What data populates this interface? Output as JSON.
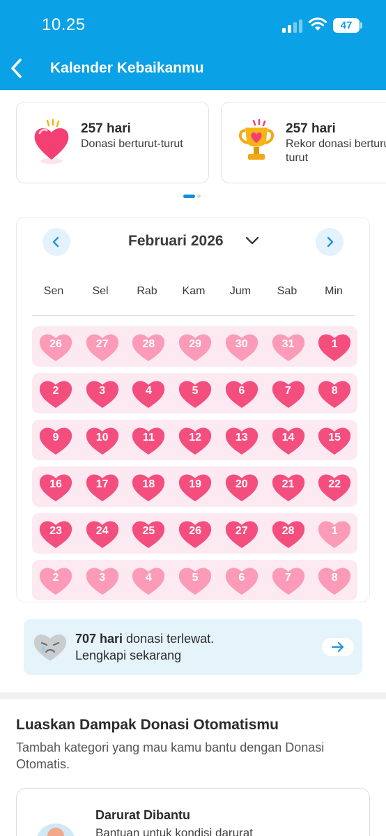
{
  "status_bar": {
    "time": "10.25",
    "battery": "47"
  },
  "header": {
    "title": "Kalender Kebaikanmu"
  },
  "stat_cards": [
    {
      "value": "257 hari",
      "label": "Donasi berturut-turut",
      "icon": "heart-icon"
    },
    {
      "value": "257 hari",
      "label": "Rekor donasi berturut-turut",
      "icon": "trophy-icon"
    }
  ],
  "calendar": {
    "month_label": "Februari 2026",
    "weekdays": [
      "Sen",
      "Sel",
      "Rab",
      "Kam",
      "Jum",
      "Sab",
      "Min"
    ],
    "colors": {
      "donated": "#f44e7f",
      "outside_month": "#fb9bb7",
      "week_bg": "#fde9f1"
    },
    "weeks": [
      [
        {
          "d": "26",
          "cur": false
        },
        {
          "d": "27",
          "cur": false
        },
        {
          "d": "28",
          "cur": false
        },
        {
          "d": "29",
          "cur": false
        },
        {
          "d": "30",
          "cur": false
        },
        {
          "d": "31",
          "cur": false
        },
        {
          "d": "1",
          "cur": true
        }
      ],
      [
        {
          "d": "2",
          "cur": true
        },
        {
          "d": "3",
          "cur": true
        },
        {
          "d": "4",
          "cur": true
        },
        {
          "d": "5",
          "cur": true
        },
        {
          "d": "6",
          "cur": true
        },
        {
          "d": "7",
          "cur": true
        },
        {
          "d": "8",
          "cur": true
        }
      ],
      [
        {
          "d": "9",
          "cur": true
        },
        {
          "d": "10",
          "cur": true
        },
        {
          "d": "11",
          "cur": true
        },
        {
          "d": "12",
          "cur": true
        },
        {
          "d": "13",
          "cur": true
        },
        {
          "d": "14",
          "cur": true
        },
        {
          "d": "15",
          "cur": true
        }
      ],
      [
        {
          "d": "16",
          "cur": true
        },
        {
          "d": "17",
          "cur": true
        },
        {
          "d": "18",
          "cur": true
        },
        {
          "d": "19",
          "cur": true
        },
        {
          "d": "20",
          "cur": true
        },
        {
          "d": "21",
          "cur": true
        },
        {
          "d": "22",
          "cur": true
        }
      ],
      [
        {
          "d": "23",
          "cur": true
        },
        {
          "d": "24",
          "cur": true
        },
        {
          "d": "25",
          "cur": true
        },
        {
          "d": "26",
          "cur": true
        },
        {
          "d": "27",
          "cur": true
        },
        {
          "d": "28",
          "cur": true
        },
        {
          "d": "1",
          "cur": false
        }
      ],
      [
        {
          "d": "2",
          "cur": false
        },
        {
          "d": "3",
          "cur": false
        },
        {
          "d": "4",
          "cur": false
        },
        {
          "d": "5",
          "cur": false
        },
        {
          "d": "6",
          "cur": false
        },
        {
          "d": "7",
          "cur": false
        },
        {
          "d": "8",
          "cur": false
        }
      ]
    ]
  },
  "missed": {
    "count": "707 hari",
    "text": " donasi terlewat.",
    "action": "Lengkapi sekarang"
  },
  "section": {
    "title": "Luaskan Dampak Donasi Otomatismu",
    "subtitle": "Tambah kategori yang mau kamu bantu dengan Donasi Otomatis."
  },
  "category_card": {
    "title": "Darurat Dibantu",
    "desc": "Bantuan untuk kondisi darurat"
  }
}
